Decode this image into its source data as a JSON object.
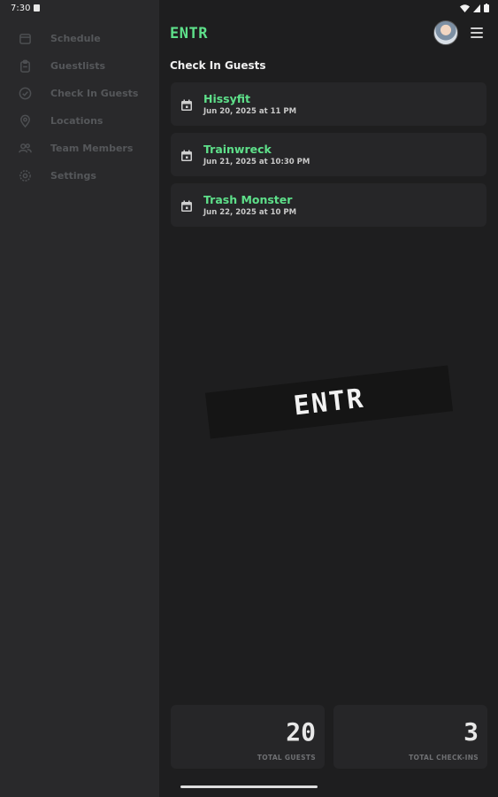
{
  "status_bar": {
    "time": "7:30"
  },
  "app": {
    "logo": "ENTR"
  },
  "sidebar": {
    "items": [
      {
        "label": "Schedule",
        "icon": "calendar-icon"
      },
      {
        "label": "Guestlists",
        "icon": "clipboard-icon"
      },
      {
        "label": "Check In Guests",
        "icon": "check-circle-icon"
      },
      {
        "label": "Locations",
        "icon": "map-pin-icon"
      },
      {
        "label": "Team Members",
        "icon": "users-icon"
      },
      {
        "label": "Settings",
        "icon": "gear-icon"
      }
    ]
  },
  "main": {
    "title": "Check In Guests",
    "events": [
      {
        "name": "Hissyfit",
        "date": "Jun 20, 2025 at 11 PM"
      },
      {
        "name": "Trainwreck",
        "date": "Jun 21, 2025 at 10:30 PM"
      },
      {
        "name": "Trash Monster",
        "date": "Jun 22, 2025 at 10 PM"
      }
    ],
    "watermark": "ENTR",
    "stats": [
      {
        "value": "20",
        "label": "TOTAL GUESTS"
      },
      {
        "value": "3",
        "label": "TOTAL CHECK-INS"
      }
    ]
  },
  "colors": {
    "accent": "#5ee08a",
    "background": "#1e1e1f",
    "sidebar": "#29292b",
    "card": "#262628"
  }
}
